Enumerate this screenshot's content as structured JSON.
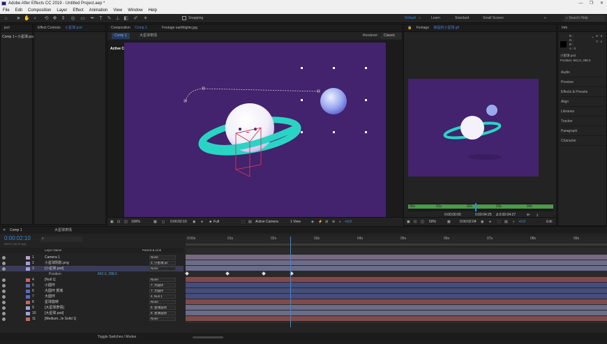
{
  "window": {
    "title": "Adobe After Effects CC 2019 - Untitled Project.aep *",
    "minimize": "—",
    "restore": "❐",
    "close": "✕"
  },
  "menu": [
    "File",
    "Edit",
    "Composition",
    "Layer",
    "Effect",
    "Animation",
    "View",
    "Window",
    "Help"
  ],
  "toolbar": {
    "snapping_label": "Snapping",
    "workspaces": [
      "Default",
      "Learn",
      "Standard",
      "Small Screen"
    ],
    "search_placeholder": "Search Help"
  },
  "project_panel": {
    "tab": "ject",
    "item": "Comp 1 • 小星球.psd"
  },
  "effects_panel": {
    "tab": "Effect Controls",
    "layer": "小星球.psd"
  },
  "comp_panel": {
    "tab_label": "Composition",
    "comp_name": "Comp 1",
    "other_tab": "Footage earthlights.jpg",
    "subtabs": [
      "Comp 1",
      "大星球表情"
    ],
    "renderer_label": "Renderer:",
    "renderer_value": "Classic 3D",
    "active_camera": "Active Camera",
    "zoom": "100%",
    "timecode": "0:00:02:10",
    "resolution": "Full",
    "view_camera": "Active Camera",
    "views": "1 View",
    "exposure": "+0.0"
  },
  "footage_panel": {
    "tab_label": "Footage",
    "file_name": "我是的小星球.gif",
    "ruler_labels": [
      "00s",
      "01s",
      "02s",
      "03s",
      "04s"
    ],
    "time_in": "0:00:00:00",
    "time_out": "0:00:04:25",
    "duration": "Δ 0:00:04:27",
    "zoom": "50%",
    "current_time": "0:00:02:04",
    "exposure": "+0.0",
    "edit_label": "Edit"
  },
  "info_panel": {
    "title": "Info",
    "channels": [
      "R :",
      "G :",
      "B :",
      "A : 0"
    ],
    "coords_x": "X : 2",
    "coords_y": "Y : 1",
    "layer_name": "小星球.psd",
    "position": "Position: 842.0, 288.0",
    "sections": [
      "Audio",
      "Preview",
      "Effects & Presets",
      "Align",
      "Libraries",
      "Tracker",
      "Paragraph",
      "Character"
    ]
  },
  "timeline": {
    "tabs": [
      "Comp 1",
      "大星球表情"
    ],
    "timecode": "0:00:02:10",
    "frame_info": "00070 (30.00 fps)",
    "col_layer_name": "Layer Name",
    "col_parent": "Parent & Link",
    "ruler": [
      "0:00s",
      "01s",
      "02s",
      "03s",
      "04s",
      "05s",
      "06s",
      "07s",
      "08s",
      "09s"
    ],
    "current_time_seconds": 2.33,
    "layers": [
      {
        "num": "1",
        "name": "Camera 1",
        "parent": "None",
        "color": "#b8a0c8"
      },
      {
        "num": "2",
        "name": "小星球阴影.png",
        "parent": "3. 小星球.ps",
        "color": "#a0a0d8"
      },
      {
        "num": "3",
        "name": "[小星球.psd]",
        "parent": "None",
        "color": "#a0a0d8"
      },
      {
        "num": "",
        "name": "Position",
        "parent": "842.0, 288.0",
        "color": ""
      },
      {
        "num": "4",
        "name": "[Null 1]",
        "parent": "None",
        "color": "#c86464"
      },
      {
        "num": "5",
        "name": "小圆环",
        "parent": "7. 大圆环",
        "color": "#5a6abf"
      },
      {
        "num": "6",
        "name": "大圆环 部底",
        "parent": "7. 大圆环",
        "color": "#5a6abf"
      },
      {
        "num": "7",
        "name": "大圆环",
        "parent": "4. Null 1",
        "color": "#5a6abf"
      },
      {
        "num": "8",
        "name": "星球旋转",
        "parent": "None",
        "color": "#c86464"
      },
      {
        "num": "9",
        "name": "[大星球表情]",
        "parent": "8. 星球旋转",
        "color": "#a0a0d8"
      },
      {
        "num": "10",
        "name": "[大星球.psd]",
        "parent": "8. 星球旋转",
        "color": "#a0a0d8"
      },
      {
        "num": "11",
        "name": "[Medium...le Solid 1]",
        "parent": "None",
        "color": "#c86464"
      }
    ],
    "toggle_label": "Toggle Switches / Modes"
  },
  "colors": {
    "comp_bg": "#43226e",
    "ring": "#2ad4c4",
    "accent": "#2d8ceb"
  }
}
